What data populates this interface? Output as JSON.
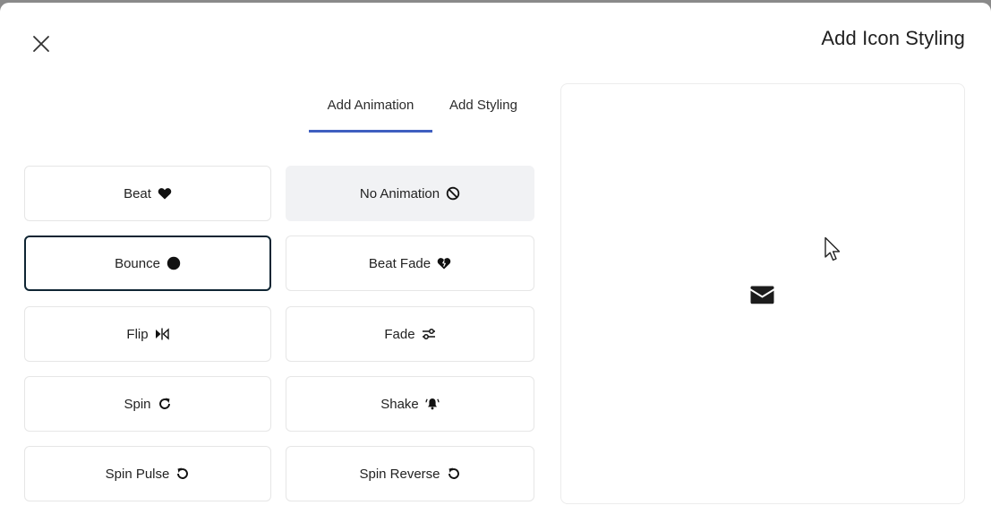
{
  "dialog": {
    "title": "Add Icon Styling",
    "close_icon": "close-icon"
  },
  "tabs": [
    {
      "label": "Add Animation",
      "active": true
    },
    {
      "label": "Add Styling",
      "active": false
    }
  ],
  "animations": [
    {
      "label": "Beat",
      "icon": "heart-icon",
      "state": "default"
    },
    {
      "label": "No Animation",
      "icon": "ban-icon",
      "state": "highlighted"
    },
    {
      "label": "Bounce",
      "icon": "circle-icon",
      "state": "selected"
    },
    {
      "label": "Beat Fade",
      "icon": "heart-crack-icon",
      "state": "default"
    },
    {
      "label": "Flip",
      "icon": "flip-icon",
      "state": "default"
    },
    {
      "label": "Fade",
      "icon": "sliders-icon",
      "state": "default"
    },
    {
      "label": "Spin",
      "icon": "rotate-right-icon",
      "state": "default"
    },
    {
      "label": "Shake",
      "icon": "bell-ringing-icon",
      "state": "default"
    },
    {
      "label": "Spin Pulse",
      "icon": "rotate-left-icon",
      "state": "default"
    },
    {
      "label": "Spin Reverse",
      "icon": "rotate-left-icon",
      "state": "default"
    }
  ],
  "preview": {
    "icon": "envelope-icon"
  },
  "colors": {
    "tab_indicator": "#3f5fc0",
    "selected_border": "#0f2533",
    "highlight_bg": "#f1f2f4"
  }
}
